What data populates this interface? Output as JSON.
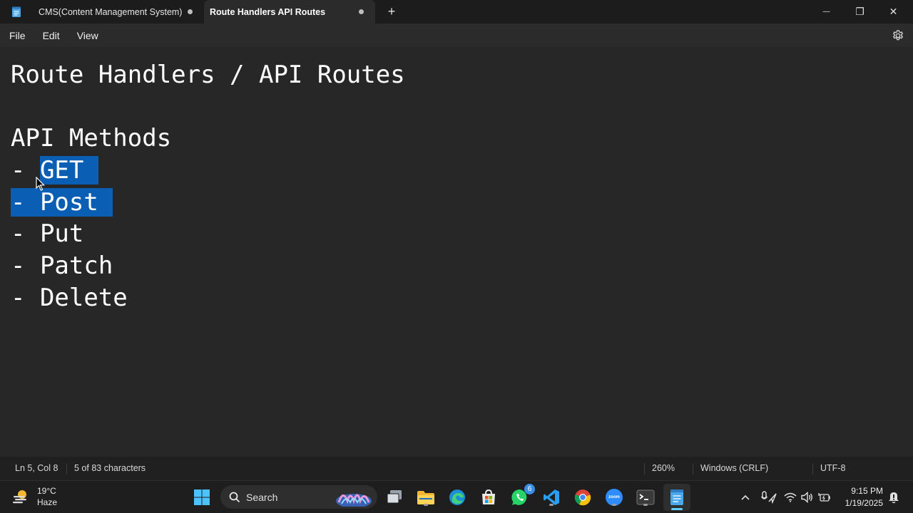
{
  "window": {
    "tabs": [
      {
        "label": "CMS(Content Management System)",
        "modified": true,
        "active": false
      },
      {
        "label": "Route Handlers  API Routes",
        "modified": true,
        "active": true
      }
    ],
    "new_tab_label": "+",
    "controls": {
      "minimize": "—",
      "maximize": "❐",
      "close": "✕"
    }
  },
  "menu": {
    "file": "File",
    "edit": "Edit",
    "view": "View"
  },
  "editor": {
    "lines": [
      "Route Handlers / API Routes",
      "",
      "API Methods",
      "- GET",
      "- Post",
      "- Put",
      "- Patch",
      "- Delete"
    ],
    "selected_text": "GET\n- Post",
    "selection_color": "#0a5fb4"
  },
  "status": {
    "position": "Ln 5, Col 8",
    "selection": "5 of 83 characters",
    "zoom": "260%",
    "line_ending": "Windows (CRLF)",
    "encoding": "UTF-8"
  },
  "taskbar": {
    "weather": {
      "temp": "19°C",
      "condition": "Haze"
    },
    "search_label": "Search",
    "whatsapp_badge": "6",
    "zoom_label": "zoom",
    "clock": {
      "time": "9:15 PM",
      "date": "1/19/2025"
    }
  },
  "colors": {
    "accent": "#60cdff",
    "editor_bg": "#272727",
    "titlebar_bg": "#1c1c1c",
    "statusbar_bg": "#202020"
  }
}
